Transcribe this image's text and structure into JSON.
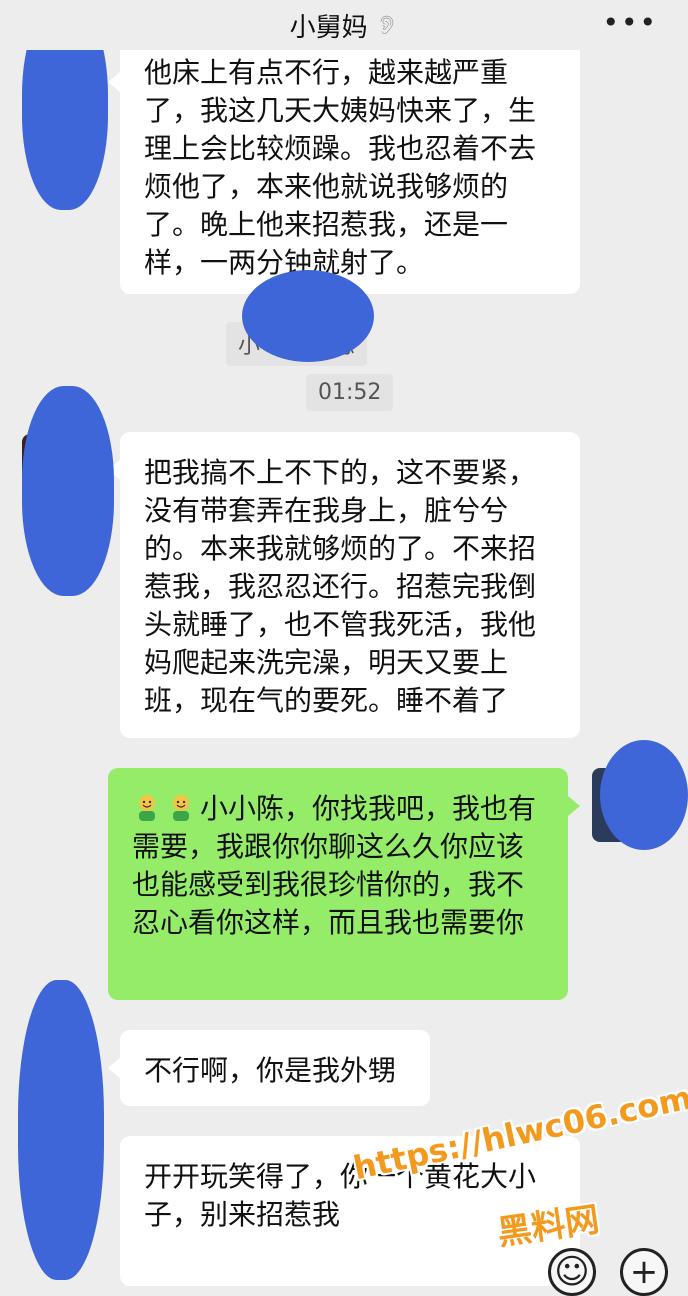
{
  "header": {
    "title": "小舅妈",
    "mute_icon": "ear-icon",
    "more_icon": "more-dots-icon",
    "more_text": "•••"
  },
  "messages": [
    {
      "direction": "in",
      "text": "他床上有点不行，越来越严重了，我这几天大姨妈快来了，生理上会比较烦躁。我也忍着不去烦他了，本来他就说我够烦的了。晚上他来招惹我，还是一样，一两分钟就射了。"
    },
    {
      "system": "小 一条消息"
    },
    {
      "time": "01:52"
    },
    {
      "direction": "in",
      "text": "把我搞不上不下的，这不要紧，没有带套弄在我身上，脏兮兮的。本来我就够烦的了。不来招惹我，我忍忍还行。招惹完我倒头就睡了，也不管我死活，我他妈爬起来洗完澡，明天又要上班，现在气的要死。睡不着了"
    },
    {
      "direction": "out",
      "emoji_name": "grin-face-icon",
      "text": "小小陈，你找我吧，我也有需要，我跟你你聊这么久你应该也能感受到我很珍惜你的，我不忍心看你这样，而且我也需要你"
    },
    {
      "direction": "in",
      "text": "不行啊，你是我外甥"
    },
    {
      "direction": "in",
      "text": "开开玩笑得了，你一个黄花大小子，别来招惹我"
    }
  ],
  "input_bar": {
    "emoji_icon": "smile-icon",
    "emoji_glyph": "☺",
    "plus_icon": "plus-circle-icon",
    "plus_glyph": "+"
  },
  "watermark": {
    "line1": "https://hlwc06.com",
    "line2": "黑料网"
  },
  "colors": {
    "background": "#ededed",
    "incoming_bubble": "#ffffff",
    "outgoing_bubble": "#95ec69",
    "redaction": "#3f66d8",
    "watermark": "#f39a1e"
  }
}
